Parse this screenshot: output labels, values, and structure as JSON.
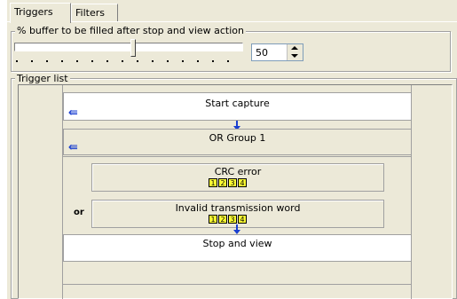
{
  "tabs": [
    {
      "label": "Triggers",
      "active": true
    },
    {
      "label": "Filters",
      "active": false
    }
  ],
  "buffer_group": {
    "title": "% buffer to be filled after stop and view action",
    "value": "50",
    "slider_position_percent": 50
  },
  "trigger_list": {
    "title": "Trigger list",
    "start_label": "Start capture",
    "group_label": "OR Group 1",
    "or_label": "or",
    "conditions": [
      {
        "label": "CRC error",
        "ports": [
          "1",
          "2",
          "3",
          "4"
        ]
      },
      {
        "label": "Invalid transmission word",
        "ports": [
          "1",
          "2",
          "3",
          "4"
        ]
      }
    ],
    "stop_label": "Stop and view"
  },
  "colors": {
    "window": "#ece9d8",
    "arrow": "#1a3fd0",
    "port_badge": "#ffff33"
  }
}
